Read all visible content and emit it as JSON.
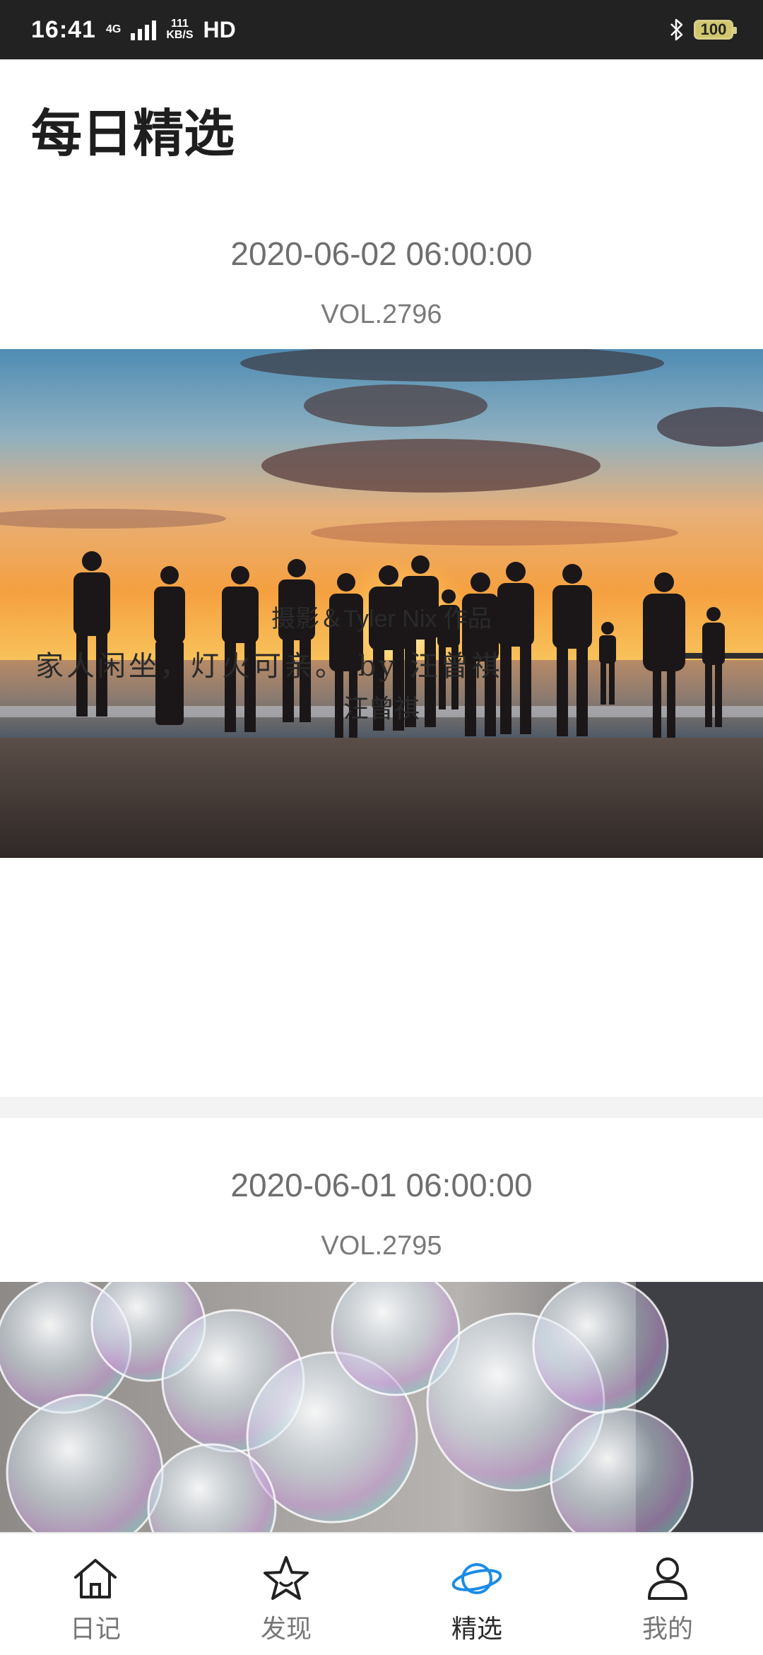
{
  "status_bar": {
    "time": "16:41",
    "network": "4G",
    "speed_value": "111",
    "speed_unit": "KB/S",
    "hd": "HD",
    "battery": "100"
  },
  "header": {
    "title": "每日精选"
  },
  "cards": [
    {
      "date": "2020-06-02 06:00:00",
      "vol": "VOL.2796",
      "credit": "摄影＆Tyler Nix 作品",
      "quote": "家人闲坐，灯火可亲。 by 汪曾祺",
      "author": "汪曾祺"
    },
    {
      "date": "2020-06-01 06:00:00",
      "vol": "VOL.2795"
    }
  ],
  "tabbar": {
    "active_color": "#1a8ce6",
    "items": [
      {
        "label": "日记",
        "icon": "home-icon"
      },
      {
        "label": "发现",
        "icon": "star-icon"
      },
      {
        "label": "精选",
        "icon": "planet-icon",
        "active": true
      },
      {
        "label": "我的",
        "icon": "user-icon"
      }
    ]
  }
}
